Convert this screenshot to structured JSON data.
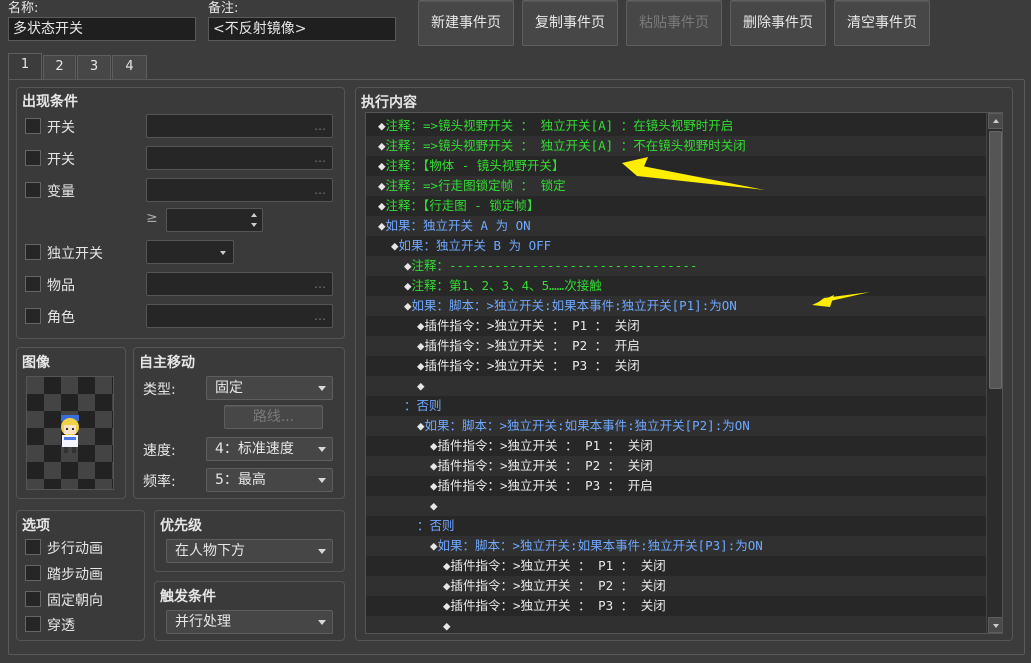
{
  "header": {
    "name_label": "名称:",
    "name_value": "多状态开关",
    "note_label": "备注:",
    "note_value": "<不反射镜像>",
    "buttons": [
      "新建事件页",
      "复制事件页",
      "粘贴事件页",
      "删除事件页",
      "清空事件页"
    ]
  },
  "tabs": [
    "1",
    "2",
    "3",
    "4"
  ],
  "conditions": {
    "title": "出现条件",
    "switch1": "开关",
    "switch2": "开关",
    "variable": "变量",
    "self_switch": "独立开关",
    "item": "物品",
    "actor": "角色",
    "ellipsis": "…",
    "gte": "≥"
  },
  "image": {
    "title": "图像"
  },
  "autonomous": {
    "title": "自主移动",
    "type_label": "类型:",
    "type_value": "固定",
    "route_button": "路线...",
    "speed_label": "速度:",
    "speed_value": "4：标准速度",
    "freq_label": "频率:",
    "freq_value": "5：最高"
  },
  "options": {
    "title": "选项",
    "items": [
      "步行动画",
      "踏步动画",
      "固定朝向",
      "穿透"
    ]
  },
  "priority": {
    "title": "优先级",
    "value": "在人物下方"
  },
  "trigger": {
    "title": "触发条件",
    "value": "并行处理"
  },
  "contents": {
    "title": "执行内容",
    "lines": [
      {
        "indent": 0,
        "text": "注释：=>镜头视野开关 ： 独立开关[A] ：在镜头视野时开启",
        "color": "green"
      },
      {
        "indent": 0,
        "text": "注释：=>镜头视野开关 ： 独立开关[A] ：不在镜头视野时关闭",
        "color": "green"
      },
      {
        "indent": 0,
        "text": "注释：【物体 - 镜头视野开关】",
        "color": "green"
      },
      {
        "indent": 0,
        "text": "注释：=>行走图锁定帧 ： 锁定",
        "color": "green"
      },
      {
        "indent": 0,
        "text": "注释：【行走图 - 锁定帧】",
        "color": "green"
      },
      {
        "indent": 0,
        "text": "如果：独立开关 A 为 ON",
        "color": "blue"
      },
      {
        "indent": 1,
        "text": "如果：独立开关 B 为 OFF",
        "color": "blue"
      },
      {
        "indent": 2,
        "text": "注释：---------------------------------",
        "color": "green"
      },
      {
        "indent": 2,
        "text": "注释：第1、2、3、4、5……次接触",
        "color": "green"
      },
      {
        "indent": 2,
        "text": "如果：脚本：>独立开关:如果本事件:独立开关[P1]:为ON",
        "color": "blue"
      },
      {
        "indent": 3,
        "text": "插件指令：>独立开关 ： P1 ： 关闭",
        "color": "white"
      },
      {
        "indent": 3,
        "text": "插件指令：>独立开关 ： P2 ： 开启",
        "color": "white"
      },
      {
        "indent": 3,
        "text": "插件指令：>独立开关 ： P3 ： 关闭",
        "color": "white"
      },
      {
        "indent": 3,
        "text": "",
        "color": "white"
      },
      {
        "indent": 2,
        "text": "：否则",
        "color": "blue",
        "nodia": true
      },
      {
        "indent": 3,
        "text": "如果：脚本：>独立开关:如果本事件:独立开关[P2]:为ON",
        "color": "blue"
      },
      {
        "indent": 4,
        "text": "插件指令：>独立开关 ： P1 ： 关闭",
        "color": "white"
      },
      {
        "indent": 4,
        "text": "插件指令：>独立开关 ： P2 ： 关闭",
        "color": "white"
      },
      {
        "indent": 4,
        "text": "插件指令：>独立开关 ： P3 ： 开启",
        "color": "white"
      },
      {
        "indent": 4,
        "text": "",
        "color": "white"
      },
      {
        "indent": 3,
        "text": "：否则",
        "color": "blue",
        "nodia": true
      },
      {
        "indent": 4,
        "text": "如果：脚本：>独立开关:如果本事件:独立开关[P3]:为ON",
        "color": "blue"
      },
      {
        "indent": 5,
        "text": "插件指令：>独立开关 ： P1 ： 关闭",
        "color": "white"
      },
      {
        "indent": 5,
        "text": "插件指令：>独立开关 ： P2 ： 关闭",
        "color": "white"
      },
      {
        "indent": 5,
        "text": "插件指令：>独立开关 ： P3 ： 关闭",
        "color": "white"
      },
      {
        "indent": 5,
        "text": "",
        "color": "white"
      }
    ]
  },
  "colors": {
    "green": "#33dd33",
    "blue": "#6fa8ff",
    "white": "#eaeaea",
    "arrow": "#ffee00"
  }
}
